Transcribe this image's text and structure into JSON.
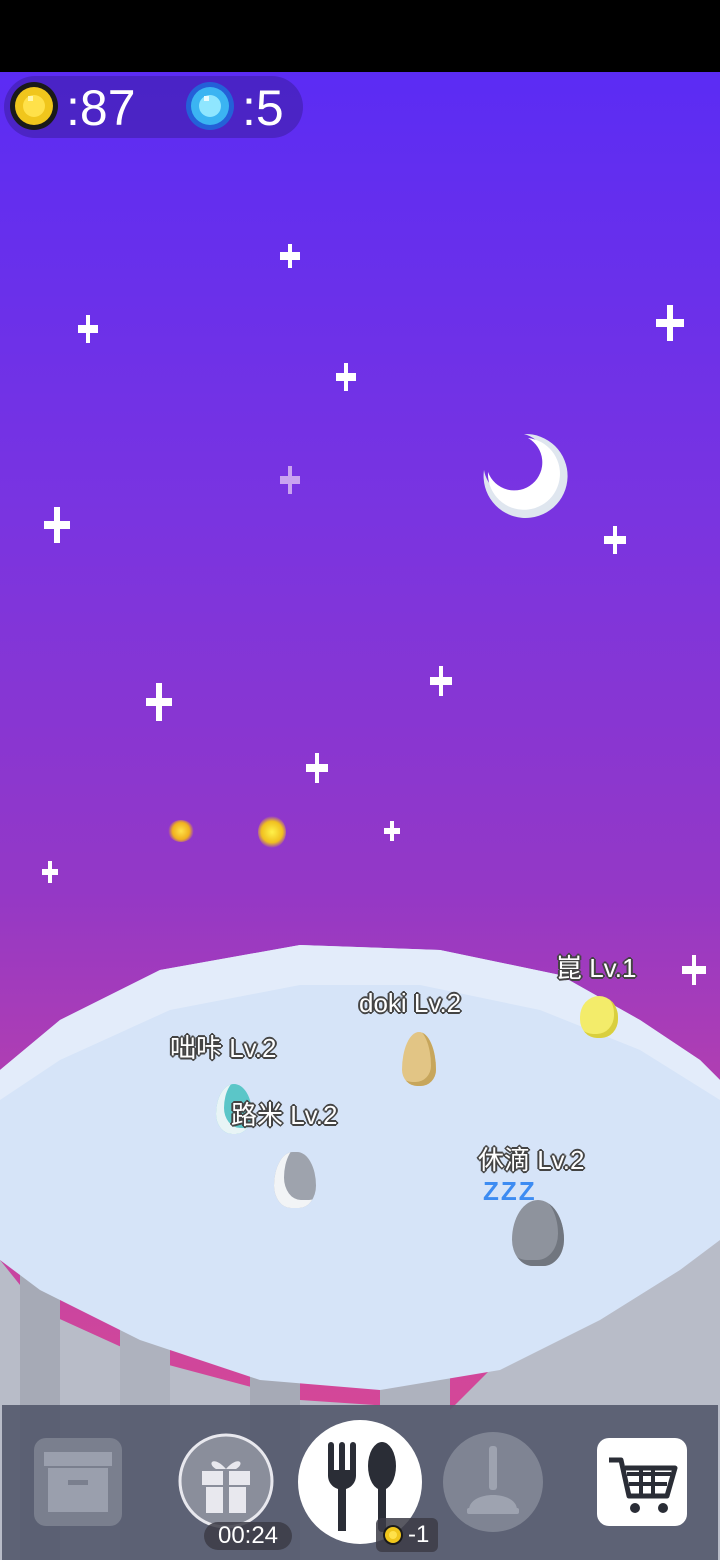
{
  "currency": {
    "gold": ":87",
    "gems": ":5"
  },
  "pets": [
    {
      "name": "崑  Lv.1"
    },
    {
      "name": "doki  Lv.2"
    },
    {
      "name": "咄咔  Lv.2"
    },
    {
      "name": "路米  Lv.2"
    },
    {
      "name": "休滴  Lv.2"
    }
  ],
  "sleep_indicator": "ZZZ",
  "toolbar": {
    "gift_timer": "00:24",
    "feed_cost": "-1"
  },
  "icons": [
    "gold-coin-icon",
    "blue-gem-icon",
    "moon-icon",
    "storage-box-icon",
    "gift-icon",
    "fork-spoon-icon",
    "plunger-icon",
    "shopping-cart-icon"
  ],
  "colors": {
    "sky_top": "#5b2cf4",
    "sky_bottom": "#e24b8e",
    "island": "#d6e4f8",
    "cliff": "#b8bcc8",
    "toolbar": "#555a6e",
    "zzz": "#3d8cf2"
  }
}
